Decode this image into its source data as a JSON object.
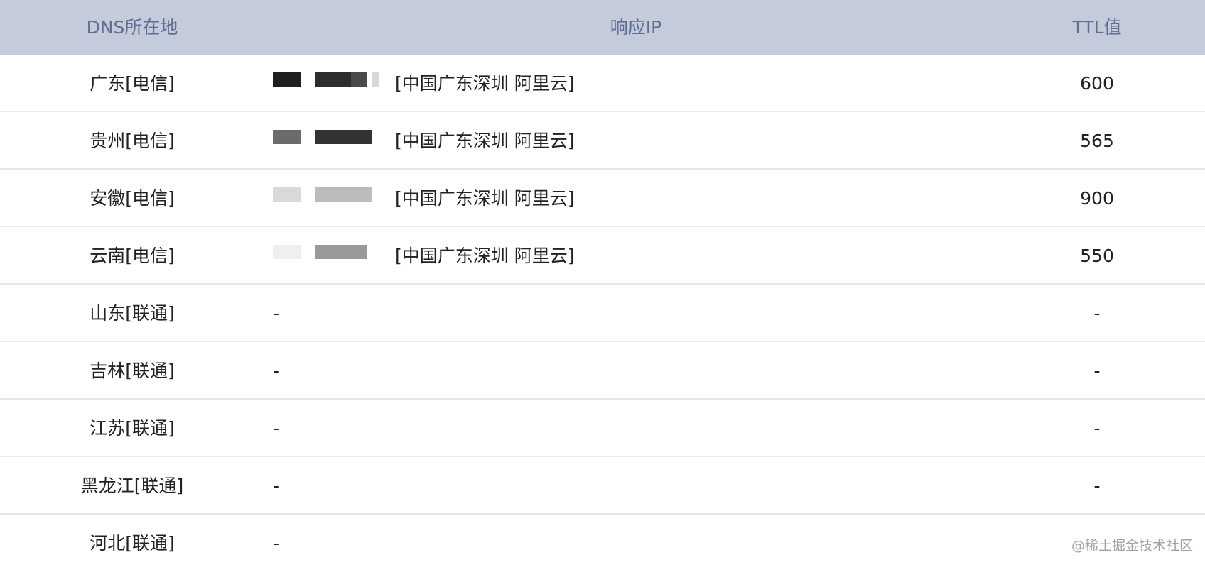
{
  "header": {
    "dns_label": "DNS所在地",
    "ip_label": "响应IP",
    "ttl_label": "TTL值"
  },
  "rows": [
    {
      "dns": "广东[电信]",
      "ip_location": "[中国广东深圳 阿里云]",
      "ttl": "600",
      "masked": true
    },
    {
      "dns": "贵州[电信]",
      "ip_location": "[中国广东深圳 阿里云]",
      "ttl": "565",
      "masked": true
    },
    {
      "dns": "安徽[电信]",
      "ip_location": "[中国广东深圳 阿里云]",
      "ttl": "900",
      "masked": true
    },
    {
      "dns": "云南[电信]",
      "ip_location": "[中国广东深圳 阿里云]",
      "ttl": "550",
      "masked": true
    },
    {
      "dns": "山东[联通]",
      "ip_location": "-",
      "ttl": "-",
      "masked": false
    },
    {
      "dns": "吉林[联通]",
      "ip_location": "-",
      "ttl": "-",
      "masked": false
    },
    {
      "dns": "江苏[联通]",
      "ip_location": "-",
      "ttl": "-",
      "masked": false
    },
    {
      "dns": "黑龙江[联通]",
      "ip_location": "-",
      "ttl": "-",
      "masked": false
    },
    {
      "dns": "河北[联通]",
      "ip_location": "-",
      "ttl": "",
      "masked": false
    }
  ],
  "watermark": "@稀土掘金技术社区",
  "colors": {
    "header_bg": "#c4ccdc",
    "header_text": "#5f6f93",
    "body_text": "#222222",
    "row_divider": "#e8e8e8"
  }
}
